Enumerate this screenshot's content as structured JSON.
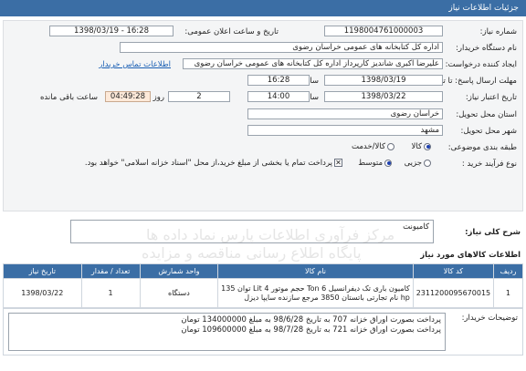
{
  "header": {
    "title": "جزئیات اطلاعات نیاز"
  },
  "form": {
    "need_number_label": "شماره نیاز:",
    "need_number": "1198004761000003",
    "announce_label": "تاریخ و ساعت اعلان عمومی:",
    "announce_value": "1398/03/19 - 16:28",
    "buyer_org_label": "نام دستگاه خریدار:",
    "buyer_org": "اداره کل  کتابخانه های عمومی  خراسان رضوی",
    "creator_label": "ایجاد کننده درخواست:",
    "creator": "علیرضا اکبری شاندیز کارپرداز اداره کل  کتابخانه های عمومی خراسان رضوی",
    "contact_link": "اطلاعات تماس خریدار",
    "send_deadline_label": "مهلت ارسال پاسخ: تا تاریخ:",
    "send_date": "1398/03/19",
    "send_time_label": "ساعت",
    "send_time": "16:28",
    "validity_label": "تاریخ اعتبار نیاز:",
    "validity_date": "1398/03/22",
    "validity_time_label": "ساعت",
    "validity_time": "14:00",
    "days_value": "2",
    "days_label": "روز و",
    "remaining_time": "04:49:28",
    "remaining_label": "ساعت باقی مانده",
    "province_label": "استان محل تحویل:",
    "province": "خراسان رضوی",
    "city_label": "شهر محل تحویل:",
    "city": "مشهد",
    "category_label": "طبقه بندی موضوعی:",
    "category_goods": "کالا",
    "category_service": "کالا/خدمت",
    "process_label": "نوع فرآیند خرید :",
    "process_partial": "جزیی",
    "process_medium": "متوسط",
    "payment_note": "پرداخت تمام یا بخشی از مبلغ خرید،از محل \"اسناد خزانه اسلامی\" خواهد بود."
  },
  "description": {
    "label": "شرح کلی نیاز:",
    "value": "کامیونت"
  },
  "watermark": {
    "line1": "مرکز فرآوری اطلاعات پارس نماد داده ها",
    "line2": "پایگاه اطلاع رسانی مناقصه و مزایده"
  },
  "items": {
    "section_title": "اطلاعات کالاهای مورد نیاز",
    "columns": [
      "ردیف",
      "کد کالا",
      "نام کالا",
      "واحد شمارش",
      "تعداد / مقدار",
      "تاریخ نیاز"
    ],
    "rows": [
      {
        "row": "1",
        "code": "2311200095670015",
        "name": "کامیون باری تک دیفرانسیل Ton 6 حجم موتور Lit 4 توان 135 hp نام تجارتی باتستان 3850 مرجع سازنده سایپا دیزل",
        "unit": "دستگاه",
        "qty": "1",
        "date": "1398/03/22"
      }
    ]
  },
  "notes": {
    "label": "توضیحات خریدار:",
    "line1": "پرداخت بصورت اوراق خزانه 707 به تاریخ 98/6/28 به مبلغ 134000000 تومان",
    "line2": "پرداخت بصورت اوراق خزانه 721 به تاریخ 98/7/28 به مبلغ 109600000 تومان"
  }
}
